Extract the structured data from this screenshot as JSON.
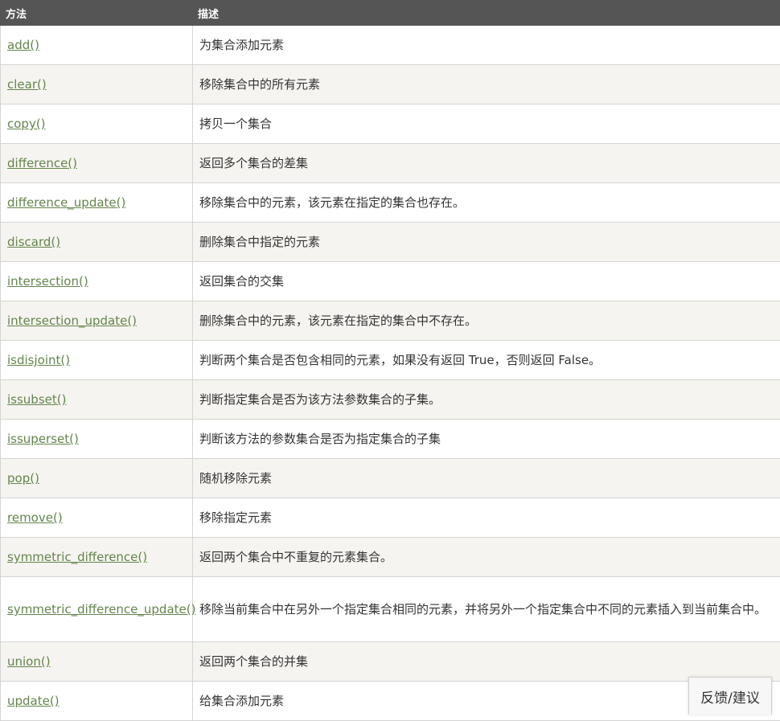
{
  "table": {
    "headers": {
      "method": "方法",
      "description": "描述"
    },
    "rows": [
      {
        "method": "add()",
        "description": "为集合添加元素"
      },
      {
        "method": "clear()",
        "description": "移除集合中的所有元素"
      },
      {
        "method": "copy()",
        "description": "拷贝一个集合"
      },
      {
        "method": "difference()",
        "description": "返回多个集合的差集"
      },
      {
        "method": "difference_update()",
        "description": "移除集合中的元素，该元素在指定的集合也存在。"
      },
      {
        "method": "discard()",
        "description": "删除集合中指定的元素"
      },
      {
        "method": "intersection()",
        "description": "返回集合的交集"
      },
      {
        "method": "intersection_update()",
        "description": "删除集合中的元素，该元素在指定的集合中不存在。"
      },
      {
        "method": "isdisjoint()",
        "description": "判断两个集合是否包含相同的元素，如果没有返回 True，否则返回 False。"
      },
      {
        "method": "issubset()",
        "description": "判断指定集合是否为该方法参数集合的子集。"
      },
      {
        "method": "issuperset()",
        "description": "判断该方法的参数集合是否为指定集合的子集"
      },
      {
        "method": "pop()",
        "description": "随机移除元素"
      },
      {
        "method": "remove()",
        "description": "移除指定元素"
      },
      {
        "method": "symmetric_difference()",
        "description": "返回两个集合中不重复的元素集合。"
      },
      {
        "method": "symmetric_difference_update()",
        "description": "移除当前集合中在另外一个指定集合相同的元素，并将另外一个指定集合中不同的元素插入到当前集合中。"
      },
      {
        "method": "union()",
        "description": "返回两个集合的并集"
      },
      {
        "method": "update()",
        "description": "给集合添加元素"
      }
    ]
  },
  "feedback": {
    "label": "反馈/建议"
  },
  "colors": {
    "header_bg": "#555555",
    "link": "#64854c",
    "stripe": "#f6f4f0"
  }
}
